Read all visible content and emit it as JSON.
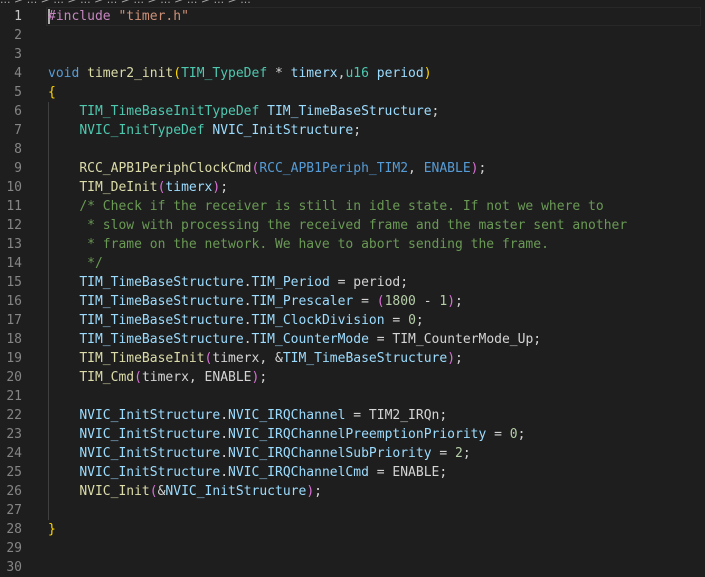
{
  "breadcrumb": "... > ... > ... > ... > ... > ... > ... > ... > ... > ...",
  "active_line": 1,
  "lines": [
    {
      "n": "1",
      "tokens": [
        {
          "c": "t-pp",
          "t": "#include"
        },
        {
          "c": "t-pl",
          "t": " "
        },
        {
          "c": "t-str",
          "t": "\"timer.h\""
        }
      ]
    },
    {
      "n": "2",
      "tokens": []
    },
    {
      "n": "3",
      "tokens": []
    },
    {
      "n": "4",
      "tokens": [
        {
          "c": "t-kw",
          "t": "void"
        },
        {
          "c": "t-pl",
          "t": " "
        },
        {
          "c": "t-fn",
          "t": "timer2_init"
        },
        {
          "c": "t-br1",
          "t": "("
        },
        {
          "c": "t-ty",
          "t": "TIM_TypeDef"
        },
        {
          "c": "t-pl",
          "t": " * "
        },
        {
          "c": "t-var",
          "t": "timerx"
        },
        {
          "c": "t-pl",
          "t": ","
        },
        {
          "c": "t-ty",
          "t": "u16"
        },
        {
          "c": "t-pl",
          "t": " "
        },
        {
          "c": "t-var",
          "t": "period"
        },
        {
          "c": "t-br1",
          "t": ")"
        }
      ]
    },
    {
      "n": "5",
      "tokens": [
        {
          "c": "t-br1",
          "t": "{"
        }
      ]
    },
    {
      "n": "6",
      "tokens": [
        {
          "c": "t-pl",
          "t": "    "
        },
        {
          "c": "t-ty",
          "t": "TIM_TimeBaseInitTypeDef"
        },
        {
          "c": "t-pl",
          "t": " "
        },
        {
          "c": "t-var",
          "t": "TIM_TimeBaseStructure"
        },
        {
          "c": "t-pl",
          "t": ";"
        }
      ]
    },
    {
      "n": "7",
      "tokens": [
        {
          "c": "t-pl",
          "t": "    "
        },
        {
          "c": "t-ty",
          "t": "NVIC_InitTypeDef"
        },
        {
          "c": "t-pl",
          "t": " "
        },
        {
          "c": "t-var",
          "t": "NVIC_InitStructure"
        },
        {
          "c": "t-pl",
          "t": ";"
        }
      ]
    },
    {
      "n": "8",
      "tokens": []
    },
    {
      "n": "9",
      "tokens": [
        {
          "c": "t-pl",
          "t": "    "
        },
        {
          "c": "t-fn",
          "t": "RCC_APB1PeriphClockCmd"
        },
        {
          "c": "t-br2",
          "t": "("
        },
        {
          "c": "t-mac",
          "t": "RCC_APB1Periph_TIM2"
        },
        {
          "c": "t-pl",
          "t": ", "
        },
        {
          "c": "t-mac",
          "t": "ENABLE"
        },
        {
          "c": "t-br2",
          "t": ")"
        },
        {
          "c": "t-pl",
          "t": ";"
        }
      ]
    },
    {
      "n": "10",
      "tokens": [
        {
          "c": "t-pl",
          "t": "    "
        },
        {
          "c": "t-fn",
          "t": "TIM_DeInit"
        },
        {
          "c": "t-br2",
          "t": "("
        },
        {
          "c": "t-var",
          "t": "timerx"
        },
        {
          "c": "t-br2",
          "t": ")"
        },
        {
          "c": "t-pl",
          "t": ";"
        }
      ]
    },
    {
      "n": "11",
      "tokens": [
        {
          "c": "t-pl",
          "t": "    "
        },
        {
          "c": "t-cm",
          "t": "/* Check if the receiver is still in idle state. If not we where to"
        }
      ]
    },
    {
      "n": "12",
      "tokens": [
        {
          "c": "t-cm",
          "t": "     * slow with processing the received frame and the master sent another"
        }
      ]
    },
    {
      "n": "13",
      "tokens": [
        {
          "c": "t-cm",
          "t": "     * frame on the network. We have to abort sending the frame."
        }
      ]
    },
    {
      "n": "14",
      "tokens": [
        {
          "c": "t-cm",
          "t": "     */"
        }
      ]
    },
    {
      "n": "15",
      "tokens": [
        {
          "c": "t-pl",
          "t": "    "
        },
        {
          "c": "t-var",
          "t": "TIM_TimeBaseStructure"
        },
        {
          "c": "t-pl",
          "t": "."
        },
        {
          "c": "t-var",
          "t": "TIM_Period"
        },
        {
          "c": "t-pl",
          "t": " = period;"
        }
      ]
    },
    {
      "n": "16",
      "tokens": [
        {
          "c": "t-pl",
          "t": "    "
        },
        {
          "c": "t-var",
          "t": "TIM_TimeBaseStructure"
        },
        {
          "c": "t-pl",
          "t": "."
        },
        {
          "c": "t-var",
          "t": "TIM_Prescaler"
        },
        {
          "c": "t-pl",
          "t": " = "
        },
        {
          "c": "t-br2",
          "t": "("
        },
        {
          "c": "t-num",
          "t": "1800"
        },
        {
          "c": "t-pl",
          "t": " - "
        },
        {
          "c": "t-num",
          "t": "1"
        },
        {
          "c": "t-br2",
          "t": ")"
        },
        {
          "c": "t-pl",
          "t": ";"
        }
      ]
    },
    {
      "n": "17",
      "tokens": [
        {
          "c": "t-pl",
          "t": "    "
        },
        {
          "c": "t-var",
          "t": "TIM_TimeBaseStructure"
        },
        {
          "c": "t-pl",
          "t": "."
        },
        {
          "c": "t-var",
          "t": "TIM_ClockDivision"
        },
        {
          "c": "t-pl",
          "t": " = "
        },
        {
          "c": "t-num",
          "t": "0"
        },
        {
          "c": "t-pl",
          "t": ";"
        }
      ]
    },
    {
      "n": "18",
      "tokens": [
        {
          "c": "t-pl",
          "t": "    "
        },
        {
          "c": "t-var",
          "t": "TIM_TimeBaseStructure"
        },
        {
          "c": "t-pl",
          "t": "."
        },
        {
          "c": "t-var",
          "t": "TIM_CounterMode"
        },
        {
          "c": "t-pl",
          "t": " = TIM_CounterMode_Up;"
        }
      ]
    },
    {
      "n": "19",
      "tokens": [
        {
          "c": "t-pl",
          "t": "    "
        },
        {
          "c": "t-fn",
          "t": "TIM_TimeBaseInit"
        },
        {
          "c": "t-br2",
          "t": "("
        },
        {
          "c": "t-pl",
          "t": "timerx, &"
        },
        {
          "c": "t-var",
          "t": "TIM_TimeBaseStructure"
        },
        {
          "c": "t-br2",
          "t": ")"
        },
        {
          "c": "t-pl",
          "t": ";"
        }
      ]
    },
    {
      "n": "20",
      "tokens": [
        {
          "c": "t-pl",
          "t": "    "
        },
        {
          "c": "t-fn",
          "t": "TIM_Cmd"
        },
        {
          "c": "t-br2",
          "t": "("
        },
        {
          "c": "t-pl",
          "t": "timerx, ENABLE"
        },
        {
          "c": "t-br2",
          "t": ")"
        },
        {
          "c": "t-pl",
          "t": ";"
        }
      ]
    },
    {
      "n": "21",
      "tokens": []
    },
    {
      "n": "22",
      "tokens": [
        {
          "c": "t-pl",
          "t": "    "
        },
        {
          "c": "t-var",
          "t": "NVIC_InitStructure"
        },
        {
          "c": "t-pl",
          "t": "."
        },
        {
          "c": "t-var",
          "t": "NVIC_IRQChannel"
        },
        {
          "c": "t-pl",
          "t": " = TIM2_IRQn;"
        }
      ]
    },
    {
      "n": "23",
      "tokens": [
        {
          "c": "t-pl",
          "t": "    "
        },
        {
          "c": "t-var",
          "t": "NVIC_InitStructure"
        },
        {
          "c": "t-pl",
          "t": "."
        },
        {
          "c": "t-var",
          "t": "NVIC_IRQChannelPreemptionPriority"
        },
        {
          "c": "t-pl",
          "t": " = "
        },
        {
          "c": "t-num",
          "t": "0"
        },
        {
          "c": "t-pl",
          "t": ";"
        }
      ]
    },
    {
      "n": "24",
      "tokens": [
        {
          "c": "t-pl",
          "t": "    "
        },
        {
          "c": "t-var",
          "t": "NVIC_InitStructure"
        },
        {
          "c": "t-pl",
          "t": "."
        },
        {
          "c": "t-var",
          "t": "NVIC_IRQChannelSubPriority"
        },
        {
          "c": "t-pl",
          "t": " = "
        },
        {
          "c": "t-num",
          "t": "2"
        },
        {
          "c": "t-pl",
          "t": ";"
        }
      ]
    },
    {
      "n": "25",
      "tokens": [
        {
          "c": "t-pl",
          "t": "    "
        },
        {
          "c": "t-var",
          "t": "NVIC_InitStructure"
        },
        {
          "c": "t-pl",
          "t": "."
        },
        {
          "c": "t-var",
          "t": "NVIC_IRQChannelCmd"
        },
        {
          "c": "t-pl",
          "t": " = ENABLE;"
        }
      ]
    },
    {
      "n": "26",
      "tokens": [
        {
          "c": "t-pl",
          "t": "    "
        },
        {
          "c": "t-fn",
          "t": "NVIC_Init"
        },
        {
          "c": "t-br2",
          "t": "("
        },
        {
          "c": "t-pl",
          "t": "&"
        },
        {
          "c": "t-var",
          "t": "NVIC_InitStructure"
        },
        {
          "c": "t-br2",
          "t": ")"
        },
        {
          "c": "t-pl",
          "t": ";"
        }
      ]
    },
    {
      "n": "27",
      "tokens": []
    },
    {
      "n": "28",
      "tokens": [
        {
          "c": "t-br1",
          "t": "}"
        }
      ]
    },
    {
      "n": "29",
      "tokens": []
    },
    {
      "n": "30",
      "tokens": []
    }
  ]
}
